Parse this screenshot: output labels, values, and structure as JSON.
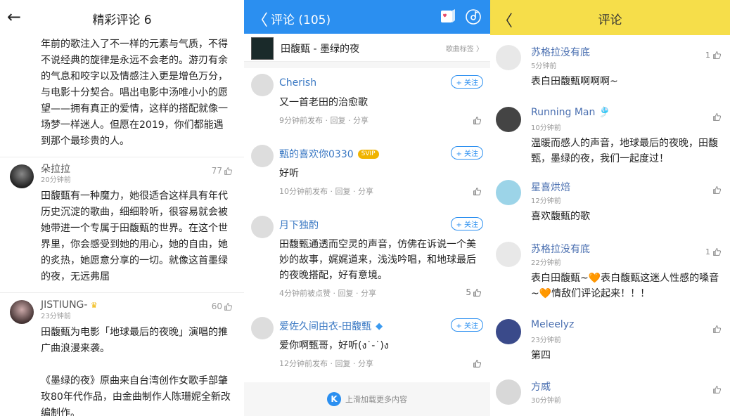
{
  "panel1": {
    "title": "精彩评论 6",
    "top_text": "年前的歌注入了不一样的元素与气质，不得不说经典的旋律是永远不会老的。游刃有余的气息和咬字以及情感注入更是增色万分，与电影十分契合。唱出电影中汤唯小小的愿望——拥有真正的爱情，这样的搭配就像一场梦一样迷人。但愿在2019，你们都能遇到那个最珍贵的人。",
    "comments": [
      {
        "name": "朵拉拉",
        "time": "20分钟前",
        "likes": "77",
        "body": "田馥甄有一种魔力，她很适合这样具有年代历史沉淀的歌曲，细细聆听，很容易就会被她带进一个专属于田馥甄的世界。在这个世界里，你会感受到她的用心，她的自由，她的炙热，她愿意分享的一切。就像这首墨绿的夜，无远弗届"
      },
      {
        "name": "JISTIUNG-",
        "time": "23分钟前",
        "likes": "60",
        "body1": "田馥甄为电影「地球最后的夜晚」演唱的推广曲浪漫来袭。",
        "body2": "《墨绿的夜》原曲来自台湾创作女歌手部肇玫80年代作品，由金曲制作人陈珊妮全新改编制作。"
      }
    ]
  },
  "panel2": {
    "title": "评论 (105)",
    "song_title": "田馥甄 - 墨绿的夜",
    "song_tag": "歌曲标签 〉",
    "follow_label": "+ 关注",
    "reply_label": "回复",
    "share_label": "分享",
    "footer": "上滑加载更多内容",
    "logo_letter": "K",
    "comments": [
      {
        "name": "Cherish",
        "badge": "",
        "body": "又一首老田的治愈歌",
        "meta": "9分钟前发布",
        "likes": ""
      },
      {
        "name": "甄的喜欢你0330",
        "badge": "SVIP",
        "body": "好听",
        "meta": "10分钟前发布",
        "likes": ""
      },
      {
        "name": "月下独酌",
        "badge": "",
        "body": "田馥甄通透而空灵的声音，仿佛在诉说一个美妙的故事，娓娓道来，浅浅吟唱，和地球最后的夜晚搭配，好有意境。",
        "meta": "4分钟前被点赞",
        "likes": "5"
      },
      {
        "name": "爱佐久间由衣-田馥甄",
        "badge": "◆",
        "body": "爱你啊甄哥，好听(ง˙-˙)ง",
        "meta": "12分钟前发布",
        "likes": ""
      }
    ]
  },
  "panel3": {
    "title": "评论",
    "comments": [
      {
        "name": "苏格拉没有底",
        "time": "5分钟前",
        "likes": "1",
        "body": "表白田馥甄啊啊啊~"
      },
      {
        "name": "Running Man 🎐",
        "time": "10分钟前",
        "likes": "",
        "body": "温暖而感人的声音，地球最后的夜晚，田馥甄，墨绿的夜，我们一起度过！"
      },
      {
        "name": "星喜烘焙",
        "time": "12分钟前",
        "likes": "",
        "body": "喜欢馥甄的歌"
      },
      {
        "name": "苏格拉没有底",
        "time": "22分钟前",
        "likes": "1",
        "body": "表白田馥甄~🧡表白馥甄这迷人性感的嗓音~🧡情敌们评论起来！！！"
      },
      {
        "name": "Meleelyz",
        "time": "23分钟前",
        "likes": "",
        "body": "第四"
      },
      {
        "name": "方威",
        "time": "30分钟前",
        "likes": "",
        "body": ""
      }
    ]
  }
}
